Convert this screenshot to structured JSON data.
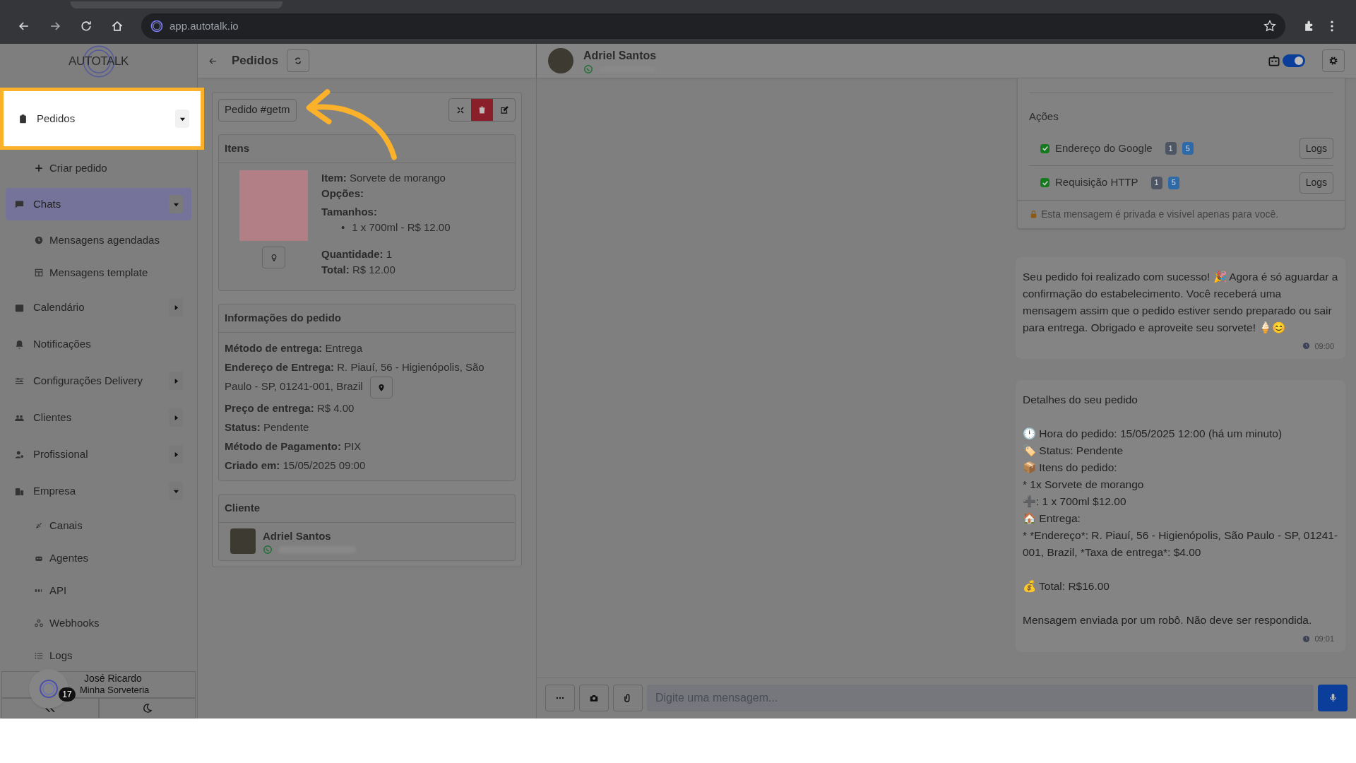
{
  "browser": {
    "url": "app.autotalk.io"
  },
  "sidebar": {
    "logo": "AUTOTALK",
    "items": [
      {
        "label": "Pedidos",
        "selected": false,
        "highlighted": true,
        "expanded": true,
        "children": [
          {
            "label": "Criar pedido"
          }
        ]
      },
      {
        "label": "Chats",
        "selected": true,
        "highlighted": false,
        "expanded": true,
        "children": [
          {
            "label": "Mensagens agendadas"
          },
          {
            "label": "Mensagens template"
          }
        ]
      },
      {
        "label": "Calendário",
        "selected": false,
        "highlighted": false,
        "expanded": false
      },
      {
        "label": "Notificações",
        "selected": false,
        "highlighted": false
      },
      {
        "label": "Configurações Delivery",
        "selected": false,
        "highlighted": false,
        "expanded": false
      },
      {
        "label": "Clientes",
        "selected": false,
        "highlighted": false,
        "expanded": false
      },
      {
        "label": "Profissional",
        "selected": false,
        "highlighted": false,
        "expanded": false
      },
      {
        "label": "Empresa",
        "selected": false,
        "highlighted": false,
        "expanded": true,
        "children": [
          {
            "label": "Canais"
          },
          {
            "label": "Agentes"
          },
          {
            "label": "API"
          },
          {
            "label": "Webhooks"
          },
          {
            "label": "Logs"
          }
        ]
      }
    ],
    "user": {
      "name": "José Ricardo",
      "company": "Minha Sorveteria",
      "badge": "17"
    }
  },
  "orders": {
    "title": "Pedidos",
    "tag": "Pedido #getm",
    "items_section": {
      "title": "Itens",
      "lines": [
        {
          "kind": "line",
          "text": "**Item:** Sorvete de morango"
        },
        {
          "kind": "line",
          "text": "**Opções:**"
        },
        {
          "kind": "line",
          "text": "**Tamanhos:**"
        },
        {
          "kind": "bullet",
          "marker": "•",
          "text": "1 x 700ml - R$ 12.00"
        },
        {
          "kind": "gap",
          "text": "**Quantidade:** 1"
        },
        {
          "kind": "line",
          "text": "**Total:** R$ 12.00"
        }
      ]
    },
    "info_section": {
      "title": "Informações do pedido",
      "lines": [
        {
          "text": "**Método de entrega:** Entrega",
          "map_button": false
        },
        {
          "text": "**Endereço de Entrega:** R. Piauí, 56 - Higienópolis, São Paulo - SP, 01241-001, Brazil",
          "map_button": true
        },
        {
          "text": "**Preço de entrega:** R$ 4.00",
          "map_button": false
        },
        {
          "text": "**Status:** Pendente",
          "map_button": false
        },
        {
          "text": "**Método de Pagamento:** PIX",
          "map_button": false
        },
        {
          "text": "**Criado em:** 15/05/2025 09:00",
          "map_button": false
        }
      ]
    },
    "client_section": {
      "title": "Cliente",
      "name": "Adriel Santos"
    }
  },
  "chat": {
    "contact": "Adriel Santos",
    "bot_on": true,
    "actions_card": {
      "title": "Ações",
      "actions": [
        {
          "label": "Endereço do Google",
          "checked": true,
          "badges": [
            "1",
            "5"
          ],
          "button": "Logs"
        },
        {
          "label": "Requisição HTTP",
          "checked": true,
          "badges": [
            "1",
            "5"
          ],
          "button": "Logs"
        }
      ],
      "note": "Esta mensagem é privada e visível apenas para você."
    },
    "messages": [
      {
        "text": "Seu pedido foi realizado com sucesso! 🎉 Agora é só aguardar a confirmação do estabelecimento. Você receberá uma mensagem assim que o pedido estiver sendo preparado ou sair para entrega. Obrigado e aproveite seu sorvete! 🍦😊",
        "time": "09:00"
      },
      {
        "text": "Detalhes do seu pedido\n\n🕛 Hora do pedido: 15/05/2025 12:00 (há um minuto)\n🏷️ Status: Pendente\n📦 Itens do pedido:\n* 1x Sorvete de morango\n➕: 1 x 700ml $12.00\n🏠 Entrega:\n* *Endereço*: R. Piauí, 56 - Higienópolis, São Paulo - SP, 01241-001, Brazil, *Taxa de entrega*: $4.00\n\n💰 Total: R$16.00\n\nMensagem enviada por um robô. Não deve ser respondida.",
        "time": "09:01"
      }
    ],
    "composer": {
      "placeholder": "Digite uma mensagem..."
    }
  }
}
